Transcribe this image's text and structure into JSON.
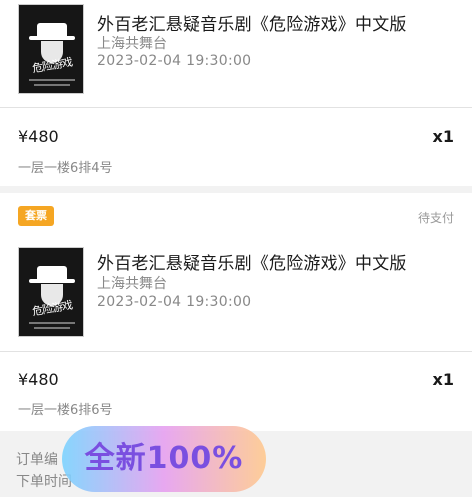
{
  "orders": [
    {
      "poster": {
        "title": "危险游戏"
      },
      "title": "外百老汇悬疑音乐剧《危险游戏》中文版",
      "venue": "上海共舞台",
      "datetime": "2023-02-04 19:30:00",
      "price": "¥480",
      "quantity": "x1",
      "seat": "一层一楼6排4号"
    },
    {
      "badge": "套票",
      "status": "待支付",
      "poster": {
        "title": "危险游戏"
      },
      "title": "外百老汇悬疑音乐剧《危险游戏》中文版",
      "venue": "上海共舞台",
      "datetime": "2023-02-04 19:30:00",
      "price": "¥480",
      "quantity": "x1",
      "seat": "一层一楼6排6号"
    }
  ],
  "footer": {
    "order_no_label": "订单编",
    "order_time_label": "下单时间"
  },
  "overlay": {
    "text": "全新100%"
  },
  "colors": {
    "badge": "#f5a623",
    "overlay_text": "#7a4fe0"
  }
}
